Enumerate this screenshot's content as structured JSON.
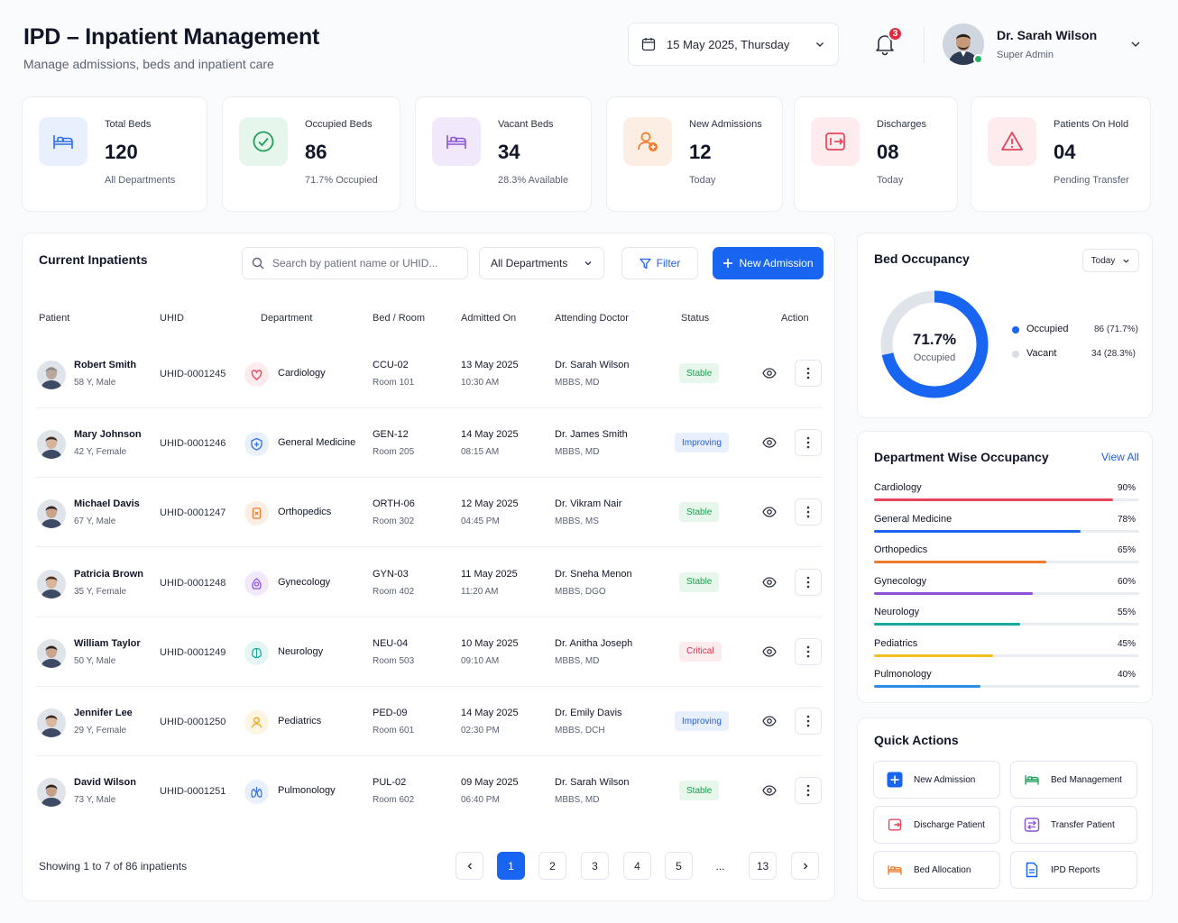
{
  "header": {
    "title": "IPD – Inpatient Management",
    "subtitle": "Manage admissions, beds and inpatient care",
    "date": "15 May 2025, Thursday",
    "notifications": "3",
    "user": {
      "name": "Dr. Sarah Wilson",
      "role": "Super Admin"
    }
  },
  "stats": [
    {
      "label": "Total Beds",
      "value": "120",
      "sub": "All Departments",
      "color": "#2f6ee8",
      "bg": "#e9f0fd",
      "icon": "bed-icon"
    },
    {
      "label": "Occupied Beds",
      "value": "86",
      "sub": "71.7% Occupied",
      "color": "#1fa05a",
      "bg": "#e6f6ed",
      "icon": "check-circle-icon"
    },
    {
      "label": "Vacant Beds",
      "value": "34",
      "sub": "28.3% Available",
      "color": "#8a52d6",
      "bg": "#f1e9fb",
      "icon": "bed-icon"
    },
    {
      "label": "New Admissions",
      "value": "12",
      "sub": "Today",
      "color": "#f07a2a",
      "bg": "#fdeee3",
      "icon": "add-user-icon"
    },
    {
      "label": "Discharges",
      "value": "08",
      "sub": "Today",
      "color": "#e5465c",
      "bg": "#fdebee",
      "icon": "discharge-icon"
    },
    {
      "label": "Patients On Hold",
      "value": "04",
      "sub": "Pending Transfer",
      "color": "#e5465c",
      "bg": "#fdebee",
      "icon": "warning-icon"
    }
  ],
  "inpatients": {
    "title": "Current Inpatients",
    "search_placeholder": "Search by patient name or UHID...",
    "department_filter": "All Departments",
    "filter_label": "Filter",
    "new_admission_label": "New Admission",
    "columns": [
      "Patient",
      "UHID",
      "Department",
      "Bed / Room",
      "Admitted On",
      "Attending Doctor",
      "Status",
      "Action"
    ],
    "rows": [
      {
        "name": "Robert Smith",
        "meta": "58 Y, Male",
        "uhid": "UHID-0001245",
        "dept": "Cardiology",
        "dept_color": "#e5465c",
        "dept_bg": "#fdebee",
        "bed": "CCU-02",
        "room": "Room 101",
        "date": "13 May 2025",
        "time": "10:30 AM",
        "doctor": "Dr. Sarah Wilson",
        "degree": "MBBS, MD",
        "status": "Stable",
        "status_type": "stable",
        "avatar_color": "#b9a89a",
        "hair": "#8a8a8a"
      },
      {
        "name": "Mary Johnson",
        "meta": "42 Y, Female",
        "uhid": "UHID-0001246",
        "dept": "General Medicine",
        "dept_color": "#2f6ee8",
        "dept_bg": "#e9f0fd",
        "bed": "GEN-12",
        "room": "Room 205",
        "date": "14 May 2025",
        "time": "08:15 AM",
        "doctor": "Dr. James Smith",
        "degree": "MBBS, MD",
        "status": "Improving",
        "status_type": "improving",
        "avatar_color": "#d6b39c",
        "hair": "#3a2a22"
      },
      {
        "name": "Michael Davis",
        "meta": "67 Y, Male",
        "uhid": "UHID-0001247",
        "dept": "Orthopedics",
        "dept_color": "#f07a2a",
        "dept_bg": "#fdeee3",
        "bed": "ORTH-06",
        "room": "Room 302",
        "date": "12 May 2025",
        "time": "04:45 PM",
        "doctor": "Dr. Vikram Nair",
        "degree": "MBBS, MS",
        "status": "Stable",
        "status_type": "stable",
        "avatar_color": "#c9a48b",
        "hair": "#2c2420"
      },
      {
        "name": "Patricia Brown",
        "meta": "35 Y, Female",
        "uhid": "UHID-0001248",
        "dept": "Gynecology",
        "dept_color": "#8a52d6",
        "dept_bg": "#f1e9fb",
        "bed": "GYN-03",
        "room": "Room 402",
        "date": "11 May 2025",
        "time": "11:20 AM",
        "doctor": "Dr. Sneha Menon",
        "degree": "MBBS, DGO",
        "status": "Stable",
        "status_type": "stable",
        "avatar_color": "#d8b49c",
        "hair": "#4a3124"
      },
      {
        "name": "William Taylor",
        "meta": "50 Y, Male",
        "uhid": "UHID-0001249",
        "dept": "Neurology",
        "dept_color": "#16a89a",
        "dept_bg": "#e4f6f4",
        "bed": "NEU-04",
        "room": "Room 503",
        "date": "10 May 2025",
        "time": "09:10 AM",
        "doctor": "Dr. Anitha Joseph",
        "degree": "MBBS, MD",
        "status": "Critical",
        "status_type": "critical",
        "avatar_color": "#c8a58c",
        "hair": "#2a221e"
      },
      {
        "name": "Jennifer Lee",
        "meta": "29 Y, Female",
        "uhid": "UHID-0001250",
        "dept": "Pediatrics",
        "dept_color": "#e8a617",
        "dept_bg": "#fdf5e2",
        "bed": "PED-09",
        "room": "Room 601",
        "date": "14 May 2025",
        "time": "02:30 PM",
        "doctor": "Dr. Emily Davis",
        "degree": "MBBS, DCH",
        "status": "Improving",
        "status_type": "improving",
        "avatar_color": "#d9b7a0",
        "hair": "#3b2820"
      },
      {
        "name": "David Wilson",
        "meta": "73 Y, Male",
        "uhid": "UHID-0001251",
        "dept": "Pulmonology",
        "dept_color": "#2f6ee8",
        "dept_bg": "#e9f0fd",
        "bed": "PUL-02",
        "room": "Room 602",
        "date": "09 May 2025",
        "time": "06:40 PM",
        "doctor": "Dr. Sarah Wilson",
        "degree": "MBBS, MD",
        "status": "Stable",
        "status_type": "stable",
        "avatar_color": "#c4a088",
        "hair": "#2a231f"
      }
    ],
    "showing": "Showing 1 to 7 of 86 inpatients",
    "pages": [
      "1",
      "2",
      "3",
      "4",
      "5",
      "...",
      "13"
    ],
    "active_page": "1"
  },
  "bed_occupancy": {
    "title": "Bed Occupancy",
    "period": "Today",
    "percent_label": "71.7%",
    "center_label": "Occupied",
    "occupied_fraction": 0.717,
    "legend": [
      {
        "name": "Occupied",
        "value": "86 (71.7%)",
        "color": "#1765f0"
      },
      {
        "name": "Vacant",
        "value": "34 (28.3%)",
        "color": "#d9dde5"
      }
    ]
  },
  "department_occupancy": {
    "title": "Department Wise Occupancy",
    "view_all": "View All",
    "items": [
      {
        "name": "Cardiology",
        "pct_label": "90%",
        "value": 90,
        "color": "#e5465c"
      },
      {
        "name": "General Medicine",
        "pct_label": "78%",
        "value": 78,
        "color": "#1765f0"
      },
      {
        "name": "Orthopedics",
        "pct_label": "65%",
        "value": 65,
        "color": "#f07a2a"
      },
      {
        "name": "Gynecology",
        "pct_label": "60%",
        "value": 60,
        "color": "#8a52d6"
      },
      {
        "name": "Neurology",
        "pct_label": "55%",
        "value": 55,
        "color": "#16a89a"
      },
      {
        "name": "Pediatrics",
        "pct_label": "45%",
        "value": 45,
        "color": "#f0c020"
      },
      {
        "name": "Pulmonology",
        "pct_label": "40%",
        "value": 40,
        "color": "#2a8ee8"
      }
    ]
  },
  "quick_actions": {
    "title": "Quick Actions",
    "items": [
      {
        "label": "New Admission",
        "color": "#1765f0",
        "icon": "plus-icon"
      },
      {
        "label": "Bed Management",
        "color": "#1fa05a",
        "icon": "bed-icon"
      },
      {
        "label": "Discharge Patient",
        "color": "#e5465c",
        "icon": "discharge-icon"
      },
      {
        "label": "Transfer Patient",
        "color": "#8a52d6",
        "icon": "transfer-icon"
      },
      {
        "label": "Bed Allocation",
        "color": "#f07a2a",
        "icon": "bed-icon"
      },
      {
        "label": "IPD Reports",
        "color": "#1765f0",
        "icon": "report-icon"
      }
    ]
  }
}
